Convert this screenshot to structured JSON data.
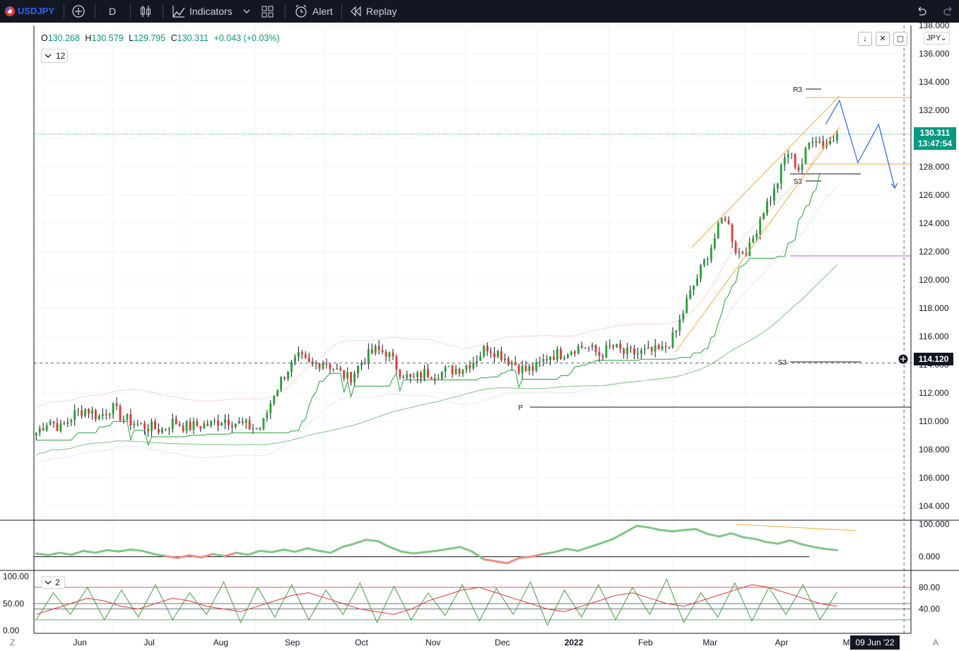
{
  "toolbar": {
    "symbol": "USDJPY",
    "interval": "D",
    "indicators_label": "Indicators",
    "alert_label": "Alert",
    "replay_label": "Replay"
  },
  "legend": {
    "open_label": "O",
    "open": "130.268",
    "high_label": "H",
    "high": "130.579",
    "low_label": "L",
    "low": "129.795",
    "close_label": "C",
    "close": "130.311",
    "change": "+0.043 (+0.03%)"
  },
  "indicator_count": "12",
  "osc_param": "2",
  "currency": "JPY",
  "price_badge": {
    "price": "130.311",
    "countdown": "13:47:54",
    "color": "#089981"
  },
  "crosshair_badge": {
    "price": "114.120"
  },
  "date_badge": "09 Jun '22",
  "corner_labels": {
    "left": "Z",
    "right": "A"
  },
  "colors": {
    "up": "#089981",
    "candle_up": "#26a236",
    "candle_down": "#e53935",
    "projection": "#2962ff"
  },
  "chart_data": {
    "type": "candlestick",
    "price_axis": {
      "ticks": [
        "138.000",
        "136.000",
        "134.000",
        "132.000",
        "130.000",
        "128.000",
        "126.000",
        "124.000",
        "122.000",
        "120.000",
        "118.000",
        "116.000",
        "114.000",
        "112.000",
        "110.000",
        "108.000",
        "106.000",
        "104.000"
      ],
      "range": [
        103,
        138
      ]
    },
    "time_axis": {
      "labels": [
        "Jun",
        "Jul",
        "Aug",
        "Sep",
        "Oct",
        "Nov",
        "Dec",
        "2022",
        "Feb",
        "Mar",
        "Apr",
        "May"
      ],
      "range": [
        "2021-05-28",
        "2022-06-12"
      ]
    },
    "last_close": 130.311,
    "crosshair_price": 114.12,
    "pivot_labels": [
      "R3",
      "S3",
      "S3",
      "P"
    ],
    "pivot_levels": [
      {
        "label": "R3",
        "value": 133.5
      },
      {
        "label": "S3",
        "value": 127.0
      },
      {
        "label": "S3",
        "value": 114.2
      },
      {
        "label": "P",
        "value": 111.0
      }
    ],
    "horizontal_levels": [
      {
        "value": 132.9,
        "color": "#f7a83a"
      },
      {
        "value": 128.2,
        "color": "#f7a83a"
      },
      {
        "value": 127.5,
        "color": "#131722"
      },
      {
        "value": 121.7,
        "color": "#e040fb"
      }
    ],
    "projection_path": [
      131.0,
      132.7,
      128.3,
      131.0,
      126.5
    ],
    "price_path": [
      109.2,
      110.1,
      109.5,
      110.5,
      110.9,
      110.3,
      111.0,
      110.2,
      109.8,
      109.6,
      109.4,
      110.0,
      109.6,
      109.7,
      109.8,
      110.2,
      109.9,
      109.6,
      109.5,
      112.0,
      113.6,
      114.5,
      113.9,
      114.3,
      113.6,
      113.0,
      114.2,
      115.0,
      114.9,
      113.6,
      112.9,
      113.4,
      113.4,
      113.6,
      113.8,
      114.3,
      115.3,
      114.8,
      114.2,
      113.6,
      113.8,
      114.7,
      114.8,
      115.2,
      115.3,
      114.7,
      115.3,
      114.8,
      114.8,
      114.9,
      115.0,
      116.0,
      118.5,
      120.5,
      122.5,
      124.7,
      121.9,
      122.2,
      124.8,
      126.3,
      129.1,
      127.8,
      130.2,
      129.6,
      130.2
    ],
    "oscillator_1": {
      "axis_ticks": [
        "100.000",
        "0.000"
      ],
      "range": [
        -40,
        110
      ],
      "values": [
        10,
        5,
        12,
        6,
        18,
        12,
        20,
        16,
        22,
        18,
        8,
        2,
        -4,
        4,
        -2,
        8,
        2,
        12,
        6,
        18,
        14,
        22,
        15,
        26,
        18,
        12,
        30,
        40,
        52,
        48,
        30,
        16,
        10,
        14,
        18,
        24,
        30,
        16,
        -8,
        -14,
        -20,
        -4,
        0,
        8,
        14,
        24,
        18,
        30,
        42,
        55,
        75,
        95,
        90,
        82,
        78,
        82,
        85,
        70,
        62,
        72,
        60,
        55,
        45,
        40,
        50,
        38,
        30,
        24,
        20
      ]
    },
    "oscillator_2": {
      "axis_ticks_left": [
        "100.00",
        "50.00",
        "0.00"
      ],
      "axis_ticks_right": [
        "80.00",
        "40.00"
      ],
      "range": [
        -5,
        110
      ],
      "levels": [
        80,
        50,
        40,
        20
      ],
      "fast": [
        20,
        70,
        30,
        80,
        20,
        75,
        25,
        85,
        20,
        70,
        30,
        90,
        15,
        80,
        25,
        85,
        20,
        75,
        30,
        88,
        15,
        82,
        20,
        70,
        28,
        85,
        18,
        78,
        30,
        90,
        10,
        75,
        25,
        85,
        20,
        80,
        30,
        95,
        15,
        70,
        25,
        88,
        18,
        80,
        30,
        85,
        20,
        72
      ],
      "slow": [
        30,
        40,
        50,
        60,
        55,
        45,
        40,
        50,
        60,
        55,
        45,
        40,
        35,
        45,
        55,
        65,
        70,
        60,
        50,
        40,
        35,
        30,
        40,
        55,
        65,
        75,
        80,
        70,
        60,
        50,
        40,
        35,
        45,
        55,
        65,
        70,
        60,
        50,
        45,
        55,
        65,
        75,
        85,
        80,
        70,
        60,
        50,
        45
      ]
    }
  }
}
